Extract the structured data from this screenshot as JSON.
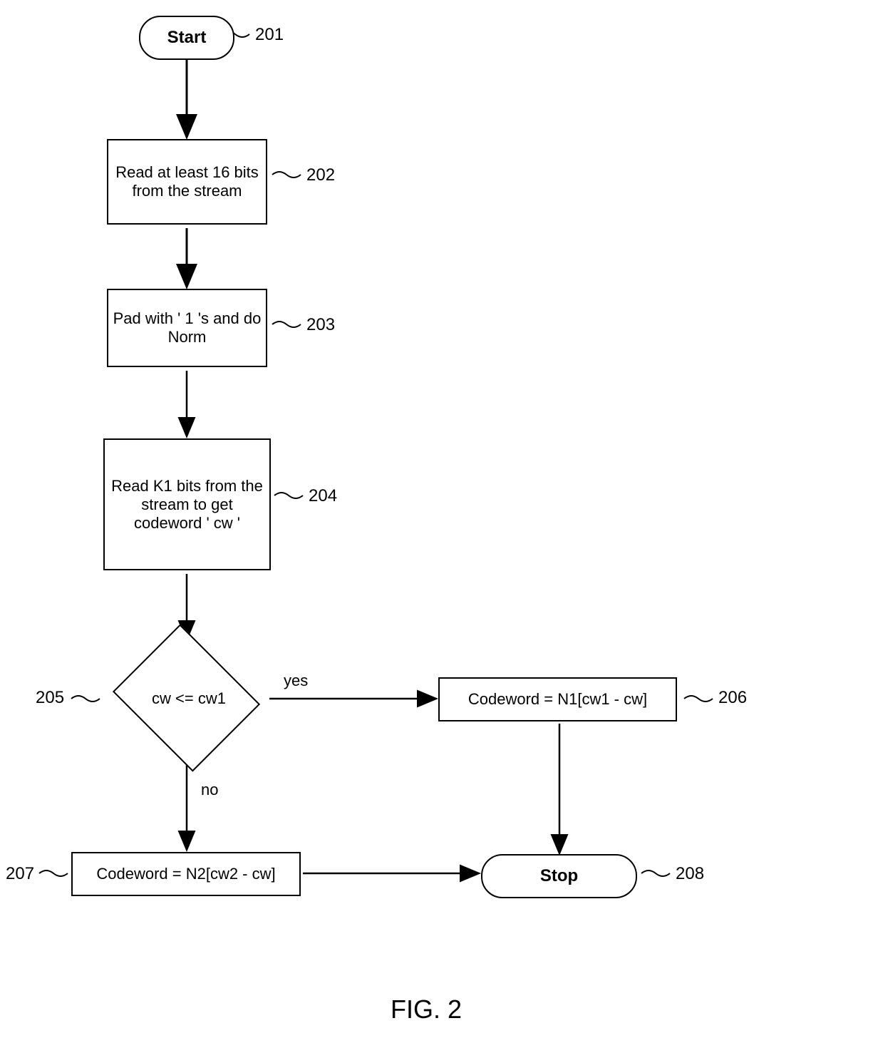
{
  "nodes": {
    "start": {
      "label": "Start",
      "ref": "201"
    },
    "read16": {
      "label": "Read at least 16 bits from the stream",
      "ref": "202"
    },
    "pad": {
      "label": "Pad with ' 1 's and do Norm",
      "ref": "203"
    },
    "readk1": {
      "label": "Read K1 bits from the stream to get codeword ' cw '",
      "ref": "204"
    },
    "decision": {
      "label": "cw <= cw1",
      "ref": "205",
      "yes": "yes",
      "no": "no"
    },
    "n1": {
      "label": "Codeword = N1[cw1 - cw]",
      "ref": "206"
    },
    "n2": {
      "label": "Codeword = N2[cw2 - cw]",
      "ref": "207"
    },
    "stop": {
      "label": "Stop",
      "ref": "208"
    }
  },
  "figure": "FIG. 2"
}
